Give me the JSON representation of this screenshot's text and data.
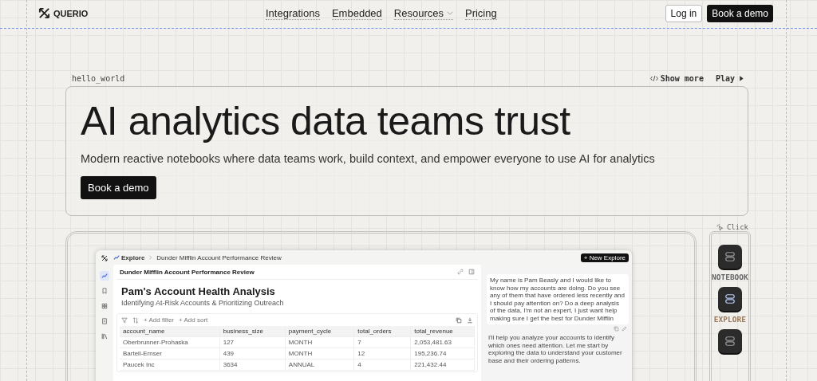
{
  "nav": {
    "brand": "QUERIO",
    "links": [
      {
        "label": "Integrations",
        "dropdown": false
      },
      {
        "label": "Embedded",
        "dropdown": false
      },
      {
        "label": "Resources",
        "dropdown": true
      },
      {
        "label": "Pricing",
        "dropdown": false
      }
    ],
    "login": "Log in",
    "cta": "Book a demo"
  },
  "hero": {
    "tag": "hello_world",
    "actions": [
      {
        "label": "Show more",
        "kind": "code"
      },
      {
        "label": "Play",
        "kind": "play"
      }
    ],
    "title": "AI analytics data teams trust",
    "subtitle": "Modern reactive notebooks where data teams work, build context, and empower everyone to use AI for analytics",
    "cta": "Book a demo"
  },
  "hint": "Click",
  "app": {
    "rail": [
      {
        "kind": "explore",
        "selected": true
      },
      {
        "kind": "bookmark",
        "selected": false
      },
      {
        "kind": "grid",
        "selected": false
      },
      {
        "kind": "doc",
        "selected": false
      },
      {
        "kind": "library",
        "selected": false
      }
    ],
    "breadcrumb": [
      "Explore",
      "Dunder Mifflin Account Performance Review"
    ],
    "new_button": "+ New Explore",
    "doc_title": "Dunder Mifflin Account Performance Review",
    "heading": "Pam's Account Health Analysis",
    "subheading": "Identifying At-Risk Accounts & Prioritizing Outreach",
    "toolbar": [
      "+ Add filter",
      "+ Add sort"
    ],
    "table": {
      "columns": [
        "account_name",
        "business_size",
        "payment_cycle",
        "total_orders",
        "total_revenue"
      ],
      "rows": [
        [
          "Oberbrunner-Prohaska",
          "127",
          "MONTH",
          "7",
          "2,053,481.63"
        ],
        [
          "Bartell-Ernser",
          "439",
          "MONTH",
          "12",
          "195,236.74"
        ],
        [
          "Paucek Inc",
          "3634",
          "ANNUAL",
          "4",
          "221,432.44"
        ]
      ]
    },
    "chat": {
      "user": "My name is Pam Beasly and I would like to know how my accounts are doing. Do you see any of them that have ordered less recently and I should pay attention on? Do a deep analysis of the data, I'm not an expert, I just want help making sure I get the best for Dunder Mifflin",
      "reply": "I'll help you analyze your accounts to identify which ones need attention. Let me start by exploring the data to understand your customer base and their ordering patterns."
    }
  },
  "modes": [
    {
      "label": "NOTEBOOK",
      "selected": false
    },
    {
      "label": "EXPLORE",
      "selected": true
    },
    {
      "selected": false
    }
  ]
}
